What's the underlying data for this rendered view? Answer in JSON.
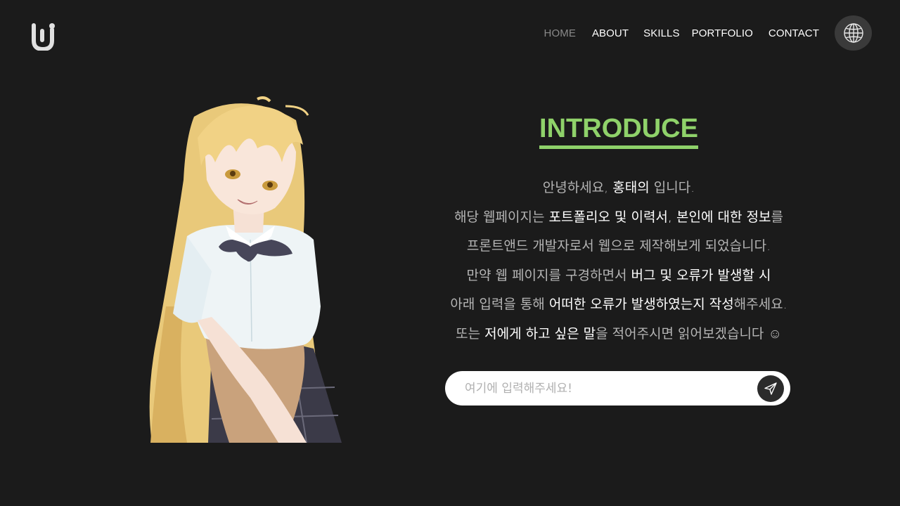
{
  "nav": {
    "items": [
      {
        "label": "HOME"
      },
      {
        "label": "ABOUT"
      },
      {
        "label": "SKILLS"
      },
      {
        "label": "PORTFOLIO"
      },
      {
        "label": "CONTACT"
      }
    ],
    "active_index": 0,
    "globe_icon": "globe-icon"
  },
  "logo": {
    "icon": "logo-mark"
  },
  "introduce": {
    "title": "INTRODUCE",
    "title_color": "#8fd26a",
    "lines": [
      [
        {
          "t": "안녕하세요, ",
          "h": false
        },
        {
          "t": "홍태의",
          "h": true
        },
        {
          "t": " 입니다.",
          "h": false
        }
      ],
      [
        {
          "t": "해당 웹페이지는 ",
          "h": false
        },
        {
          "t": "포트폴리오 및 이력서, 본인에 대한 정보",
          "h": true
        },
        {
          "t": "를",
          "h": false
        }
      ],
      [
        {
          "t": "프론트앤드 개발자로서 웹으로 제작해보게 되었습니다.",
          "h": false
        }
      ],
      [
        {
          "t": "만약 웹 페이지를 구경하면서 ",
          "h": false
        },
        {
          "t": "버그 및 오류가 발생할 시",
          "h": true
        }
      ],
      [
        {
          "t": "아래 입력을 통해 ",
          "h": false
        },
        {
          "t": "어떠한 오류가 발생하였는지 작성",
          "h": true
        },
        {
          "t": "해주세요.",
          "h": false
        }
      ],
      [
        {
          "t": "또는 ",
          "h": false
        },
        {
          "t": "저에게 하고 싶은 말",
          "h": true
        },
        {
          "t": "을 적어주시면 읽어보겠습니다 ",
          "h": false
        },
        {
          "t": "☺",
          "h": false
        }
      ]
    ]
  },
  "message": {
    "placeholder": "여기에 입력해주세요!",
    "value": "",
    "send_icon": "send-icon"
  },
  "colors": {
    "background": "#1b1b1b",
    "accent": "#8fd26a",
    "nav_active": "#8a8a8a"
  }
}
